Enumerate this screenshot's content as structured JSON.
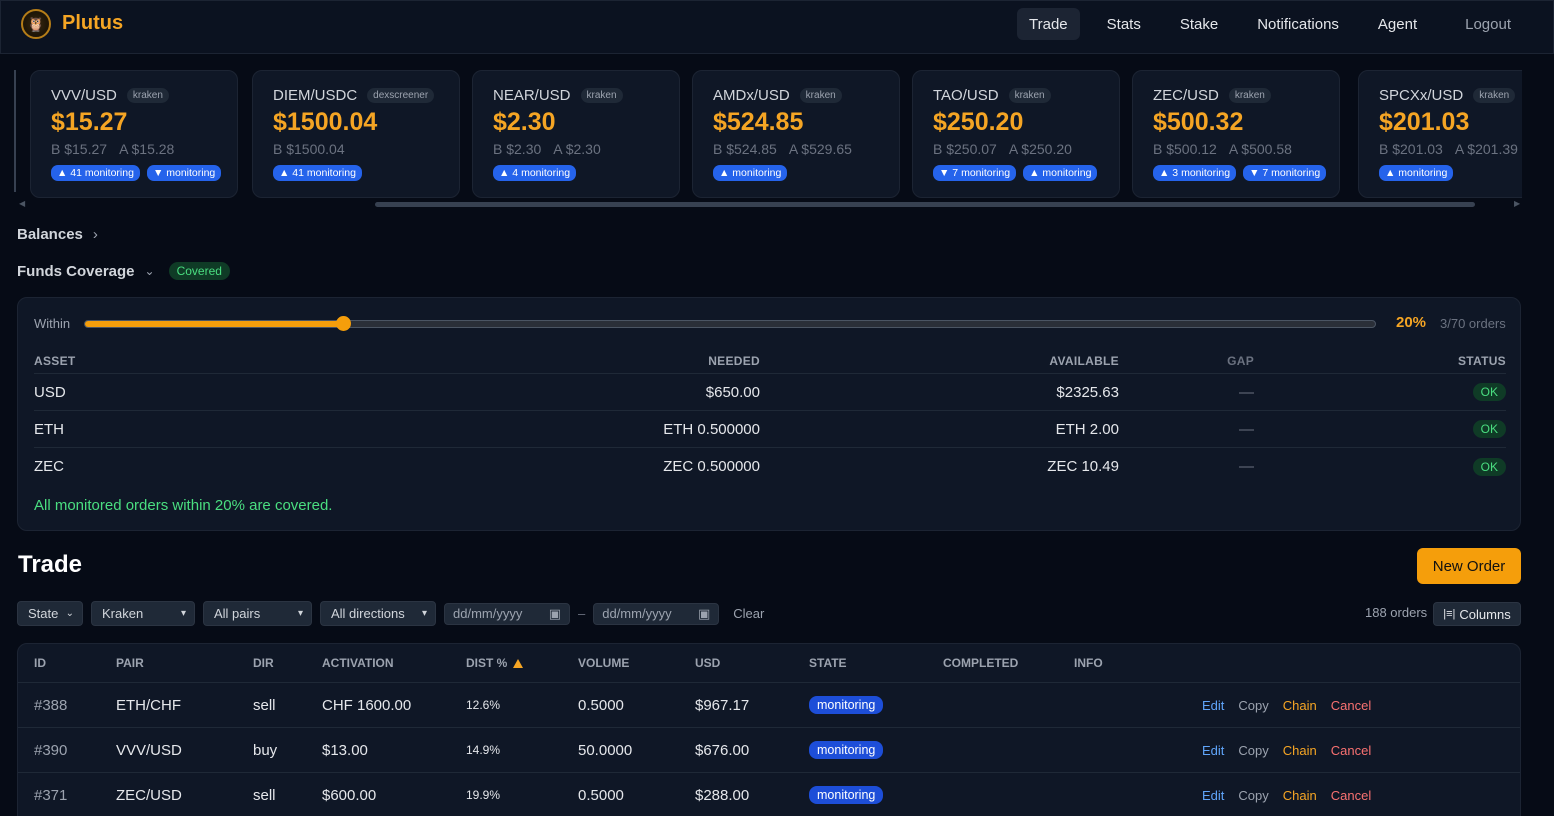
{
  "app": {
    "name": "Plutus"
  },
  "nav": {
    "items": [
      {
        "label": "Trade",
        "active": true
      },
      {
        "label": "Stats"
      },
      {
        "label": "Stake"
      },
      {
        "label": "Notifications"
      },
      {
        "label": "Agent"
      }
    ],
    "logout": "Logout"
  },
  "tickers": [
    {
      "pair": "VVV/USD",
      "exchange": "kraken",
      "price": "$15.27",
      "bid": "B $15.27",
      "ask": "A $15.28",
      "chips": [
        "▲ 41 monitoring",
        "▼ monitoring"
      ]
    },
    {
      "pair": "DIEM/USDC",
      "exchange": "dexscreener",
      "price": "$1500.04",
      "bid": "B $1500.04",
      "ask": "",
      "chips": [
        "▲ 41 monitoring"
      ]
    },
    {
      "pair": "NEAR/USD",
      "exchange": "kraken",
      "price": "$2.30",
      "bid": "B $2.30",
      "ask": "A $2.30",
      "chips": [
        "▲ 4 monitoring"
      ]
    },
    {
      "pair": "AMDx/USD",
      "exchange": "kraken",
      "price": "$524.85",
      "bid": "B $524.85",
      "ask": "A $529.65",
      "chips": [
        "▲ monitoring"
      ]
    },
    {
      "pair": "TAO/USD",
      "exchange": "kraken",
      "price": "$250.20",
      "bid": "B $250.07",
      "ask": "A $250.20",
      "chips": [
        "▼ 7 monitoring",
        "▲ monitoring"
      ]
    },
    {
      "pair": "ZEC/USD",
      "exchange": "kraken",
      "price": "$500.32",
      "bid": "B $500.12",
      "ask": "A $500.58",
      "chips": [
        "▲ 3 monitoring",
        "▼ 7 monitoring"
      ]
    },
    {
      "pair": "SPCXx/USD",
      "exchange": "kraken",
      "price": "$201.03",
      "bid": "B $201.03",
      "ask": "A $201.39",
      "chips": [
        "▲ monitoring"
      ]
    }
  ],
  "balances": {
    "label": "Balances",
    "chevron": "›"
  },
  "coverage": {
    "label": "Funds Coverage",
    "chevron": "⌄",
    "badge": "Covered",
    "within_label": "Within",
    "within_value": 0.2,
    "pct": "20%",
    "orders": "3/70 orders",
    "headers": {
      "asset": "ASSET",
      "needed": "NEEDED",
      "available": "AVAILABLE",
      "gap": "GAP",
      "status": "STATUS"
    },
    "rows": [
      {
        "asset": "USD",
        "needed": "$650.00",
        "available": "$2325.63",
        "gap": "—",
        "status": "OK"
      },
      {
        "asset": "ETH",
        "needed": "ETH 0.500000",
        "available": "ETH 2.00",
        "gap": "—",
        "status": "OK"
      },
      {
        "asset": "ZEC",
        "needed": "ZEC 0.500000",
        "available": "ZEC 10.49",
        "gap": "—",
        "status": "OK"
      }
    ],
    "message": "All monitored orders within 20% are covered."
  },
  "trade": {
    "title": "Trade",
    "new_order": "New Order",
    "filters": {
      "state": "State",
      "exchange": "Kraken",
      "pairs": "All pairs",
      "directions": "All directions",
      "date_from_placeholder": "dd/mm/yyyy",
      "date_sep": "–",
      "date_to_placeholder": "dd/mm/yyyy",
      "clear": "Clear"
    },
    "orders_total": "188 orders",
    "columns_button": "Columns",
    "headers": {
      "id": "ID",
      "pair": "PAIR",
      "dir": "DIR",
      "activation": "ACTIVATION",
      "dist": "DIST %",
      "volume": "VOLUME",
      "usd": "USD",
      "state": "STATE",
      "completed": "COMPLETED",
      "info": "INFO"
    },
    "actions": {
      "edit": "Edit",
      "copy": "Copy",
      "chain": "Chain",
      "cancel": "Cancel"
    },
    "rows": [
      {
        "id": "#388",
        "pair": "ETH/CHF",
        "dir": "sell",
        "activation": "CHF 1600.00",
        "dist": "12.6%",
        "volume": "0.5000",
        "usd": "$967.17",
        "state": "monitoring"
      },
      {
        "id": "#390",
        "pair": "VVV/USD",
        "dir": "buy",
        "activation": "$13.00",
        "dist": "14.9%",
        "volume": "50.0000",
        "usd": "$676.00",
        "state": "monitoring"
      },
      {
        "id": "#371",
        "pair": "ZEC/USD",
        "dir": "sell",
        "activation": "$600.00",
        "dist": "19.9%",
        "volume": "0.5000",
        "usd": "$288.00",
        "state": "monitoring"
      }
    ]
  }
}
